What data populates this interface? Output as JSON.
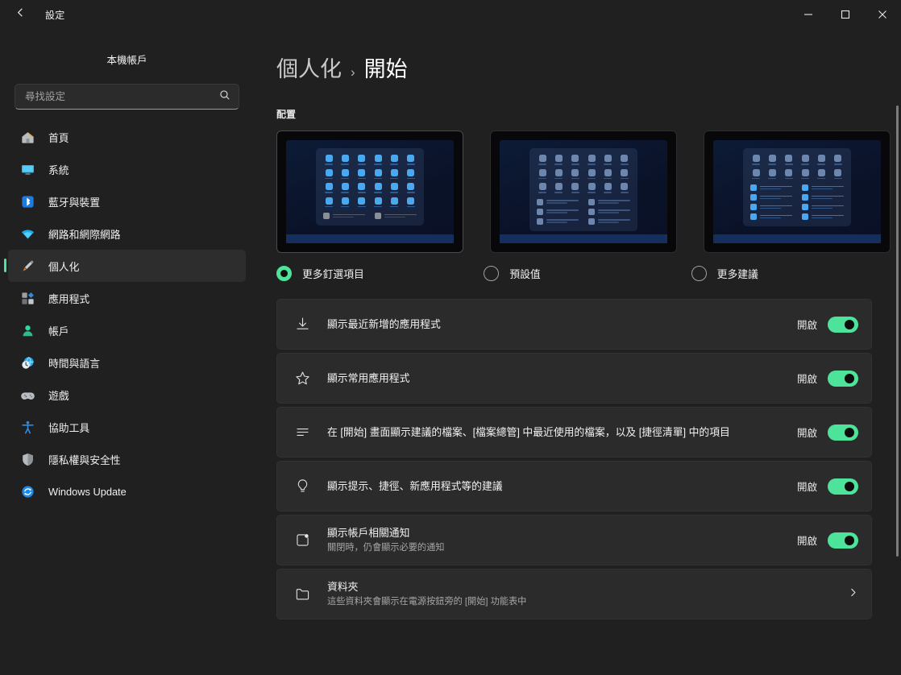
{
  "window": {
    "app_title": "設定",
    "back_icon": "back-arrow-icon",
    "minimize_label": "最小化",
    "maximize_label": "最大化",
    "close_label": "關閉"
  },
  "sidebar": {
    "account_name": "本機帳戶",
    "search": {
      "placeholder": "尋找設定",
      "value": "",
      "icon": "search-icon"
    },
    "items": [
      {
        "label": "首頁",
        "icon": "home-icon",
        "active": false
      },
      {
        "label": "系統",
        "icon": "system-icon",
        "active": false
      },
      {
        "label": "藍牙與裝置",
        "icon": "bluetooth-icon",
        "active": false
      },
      {
        "label": "網路和網際網路",
        "icon": "network-icon",
        "active": false
      },
      {
        "label": "個人化",
        "icon": "personalization-icon",
        "active": true
      },
      {
        "label": "應用程式",
        "icon": "apps-icon",
        "active": false
      },
      {
        "label": "帳戶",
        "icon": "accounts-icon",
        "active": false
      },
      {
        "label": "時間與語言",
        "icon": "time-language-icon",
        "active": false
      },
      {
        "label": "遊戲",
        "icon": "gaming-icon",
        "active": false
      },
      {
        "label": "協助工具",
        "icon": "accessibility-icon",
        "active": false
      },
      {
        "label": "隱私權與安全性",
        "icon": "privacy-icon",
        "active": false
      },
      {
        "label": "Windows Update",
        "icon": "windows-update-icon",
        "active": false
      }
    ]
  },
  "main": {
    "breadcrumb": {
      "parent": "個人化",
      "separator": "›",
      "current": "開始"
    },
    "section_label": "配置",
    "layout_options": [
      {
        "label": "更多釘選項目",
        "selected": true,
        "preview": "more-pins",
        "pin_rows": 4,
        "rec_rows": 1
      },
      {
        "label": "預設值",
        "selected": false,
        "preview": "default",
        "pin_rows": 3,
        "rec_rows": 3
      },
      {
        "label": "更多建議",
        "selected": false,
        "preview": "more-recommendations",
        "pin_rows": 2,
        "rec_rows": 4
      }
    ],
    "settings": [
      {
        "icon": "download-icon",
        "title": "顯示最近新增的應用程式",
        "subtitle": "",
        "control": "toggle",
        "toggle_state_label": "開啟",
        "toggle_on": true
      },
      {
        "icon": "star-icon",
        "title": "顯示常用應用程式",
        "subtitle": "",
        "control": "toggle",
        "toggle_state_label": "開啟",
        "toggle_on": true
      },
      {
        "icon": "list-lines-icon",
        "title": "在 [開始] 畫面顯示建議的檔案、[檔案總管] 中最近使用的檔案，以及 [捷徑清單] 中的項目",
        "subtitle": "",
        "control": "toggle",
        "toggle_state_label": "開啟",
        "toggle_on": true
      },
      {
        "icon": "lightbulb-icon",
        "title": "顯示提示、捷徑、新應用程式等的建議",
        "subtitle": "",
        "control": "toggle",
        "toggle_state_label": "開啟",
        "toggle_on": true
      },
      {
        "icon": "notification-badge-icon",
        "title": "顯示帳戶相關通知",
        "subtitle": "關閉時，仍會顯示必要的通知",
        "control": "toggle",
        "toggle_state_label": "開啟",
        "toggle_on": true
      },
      {
        "icon": "folder-icon",
        "title": "資料夾",
        "subtitle": "這些資料夾會顯示在電源按鈕旁的 [開始] 功能表中",
        "control": "chevron",
        "toggle_state_label": "",
        "toggle_on": false
      }
    ]
  },
  "colors": {
    "accent": "#4ee39a",
    "window_bg": "#202020",
    "card_bg": "#2b2b2b",
    "text_primary": "#f3f3f3",
    "text_secondary": "#a6a6a6"
  }
}
